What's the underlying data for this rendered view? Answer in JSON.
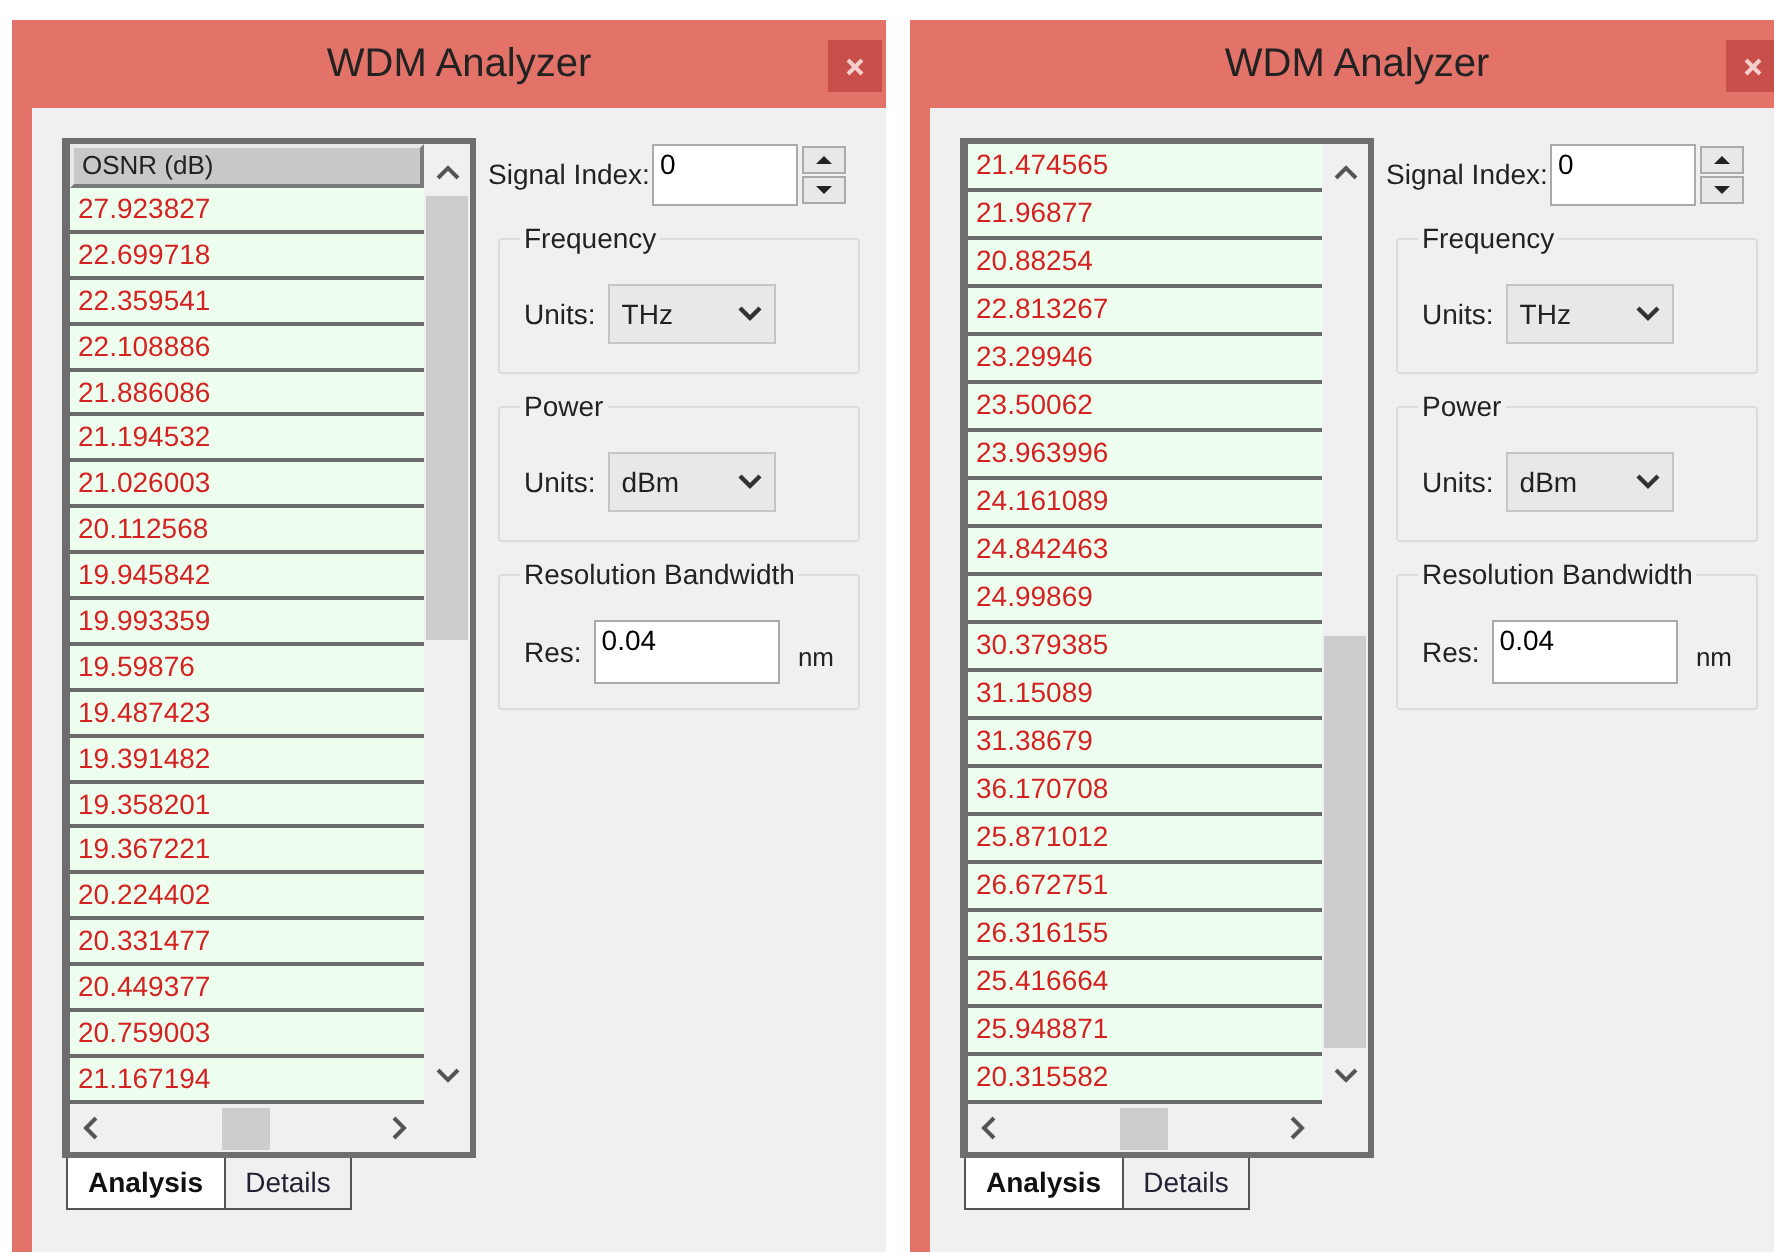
{
  "windows": [
    {
      "title": "WDM Analyzer",
      "list": {
        "header": "OSNR (dB)",
        "rows": [
          "27.923827",
          "22.699718",
          "22.359541",
          "22.108886",
          "21.886086",
          "21.194532",
          "21.026003",
          "20.112568",
          "19.945842",
          "19.993359",
          "19.59876",
          "19.487423",
          "19.391482",
          "19.358201",
          "19.367221",
          "20.224402",
          "20.331477",
          "20.449377",
          "20.759003",
          "21.167194"
        ]
      },
      "signal_index": {
        "label": "Signal Index:",
        "value": "0"
      },
      "frequency": {
        "title": "Frequency",
        "label": "Units:",
        "value": "THz"
      },
      "power": {
        "title": "Power",
        "label": "Units:",
        "value": "dBm"
      },
      "resolution": {
        "title": "Resolution Bandwidth",
        "label": "Res:",
        "value": "0.04",
        "unit": "nm"
      },
      "tabs": [
        {
          "label": "Analysis",
          "selected": true
        },
        {
          "label": "Details",
          "selected": false
        }
      ]
    },
    {
      "title": "WDM Analyzer",
      "list": {
        "rows": [
          "21.474565",
          "21.96877",
          "20.88254",
          "22.813267",
          "23.29946",
          "23.50062",
          "23.963996",
          "24.161089",
          "24.842463",
          "24.99869",
          "30.379385",
          "31.15089",
          "31.38679",
          "36.170708",
          "25.871012",
          "26.672751",
          "26.316155",
          "25.416664",
          "25.948871",
          "20.315582"
        ]
      },
      "signal_index": {
        "label": "Signal Index:",
        "value": "0"
      },
      "frequency": {
        "title": "Frequency",
        "label": "Units:",
        "value": "THz"
      },
      "power": {
        "title": "Power",
        "label": "Units:",
        "value": "dBm"
      },
      "resolution": {
        "title": "Resolution Bandwidth",
        "label": "Res:",
        "value": "0.04",
        "unit": "nm"
      },
      "tabs": [
        {
          "label": "Analysis",
          "selected": true
        },
        {
          "label": "Details",
          "selected": false
        }
      ]
    }
  ]
}
